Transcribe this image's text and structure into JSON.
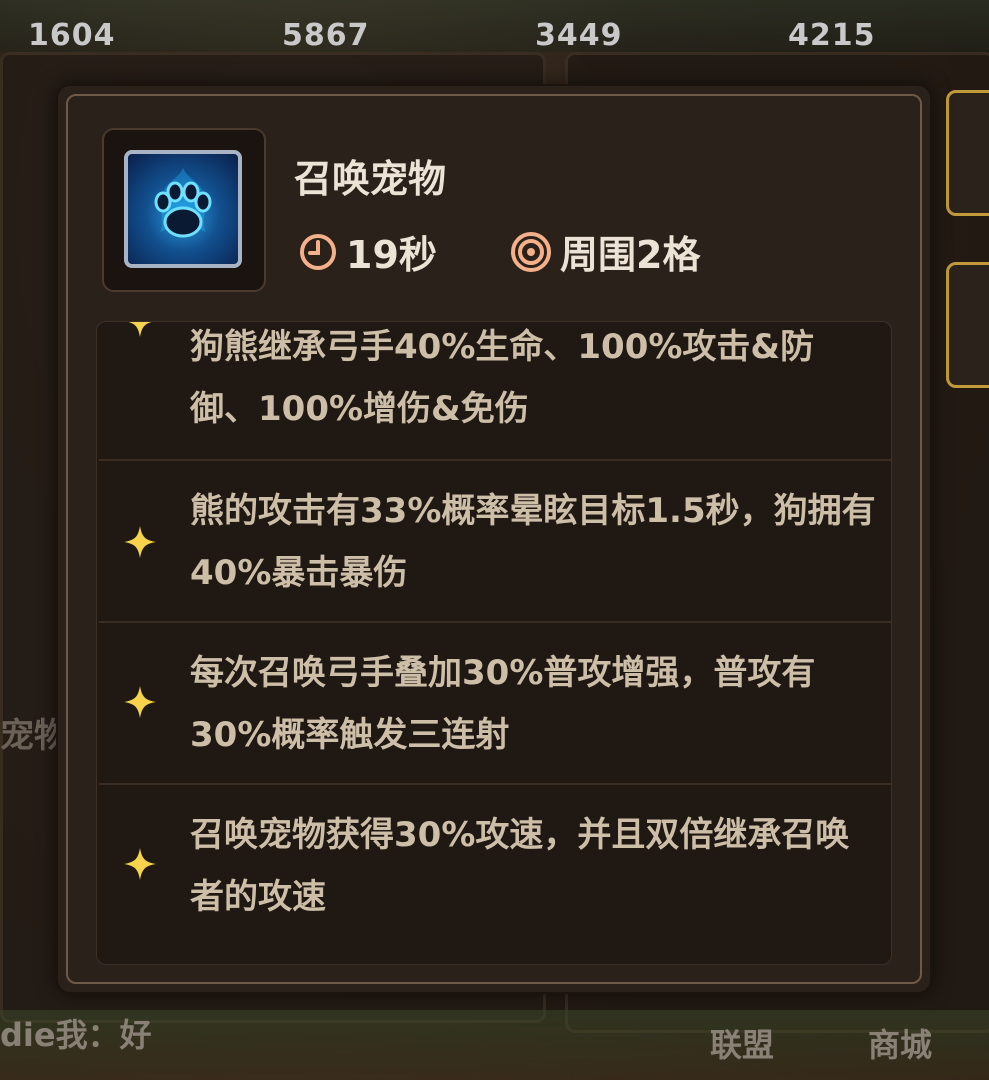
{
  "background": {
    "resources": [
      "1604",
      "5867",
      "3449",
      "4215"
    ],
    "partial_labels": {
      "pet_label": "宠物",
      "chat": "die我：好",
      "nav_alliance": "联盟",
      "nav_shop": "商城"
    }
  },
  "skill": {
    "name": "召唤宠物",
    "icon": "blue-paw-icon",
    "cooldown_icon": "clock-icon",
    "cooldown": "19秒",
    "range_icon": "target-icon",
    "range": "周围2格",
    "effects": [
      {
        "icon": "sparkle-icon",
        "text": "狗熊继承弓手40%生命、100%攻击&防御、100%增伤&免伤"
      },
      {
        "icon": "sparkle-icon",
        "text": "熊的攻击有33%概率晕眩目标1.5秒，狗拥有40%暴击暴伤"
      },
      {
        "icon": "sparkle-icon",
        "text": "每次召唤弓手叠加30%普攻增强，普攻有30%概率触发三连射"
      },
      {
        "icon": "sparkle-icon",
        "text": "召唤宠物获得30%攻速，并且双倍继承召唤者的攻速"
      }
    ]
  },
  "colors": {
    "title_text": "#ece3d6",
    "effect_text": "#cdbea8",
    "accent_icon": "#f3b08a",
    "sparkle": "#f5d34a"
  }
}
